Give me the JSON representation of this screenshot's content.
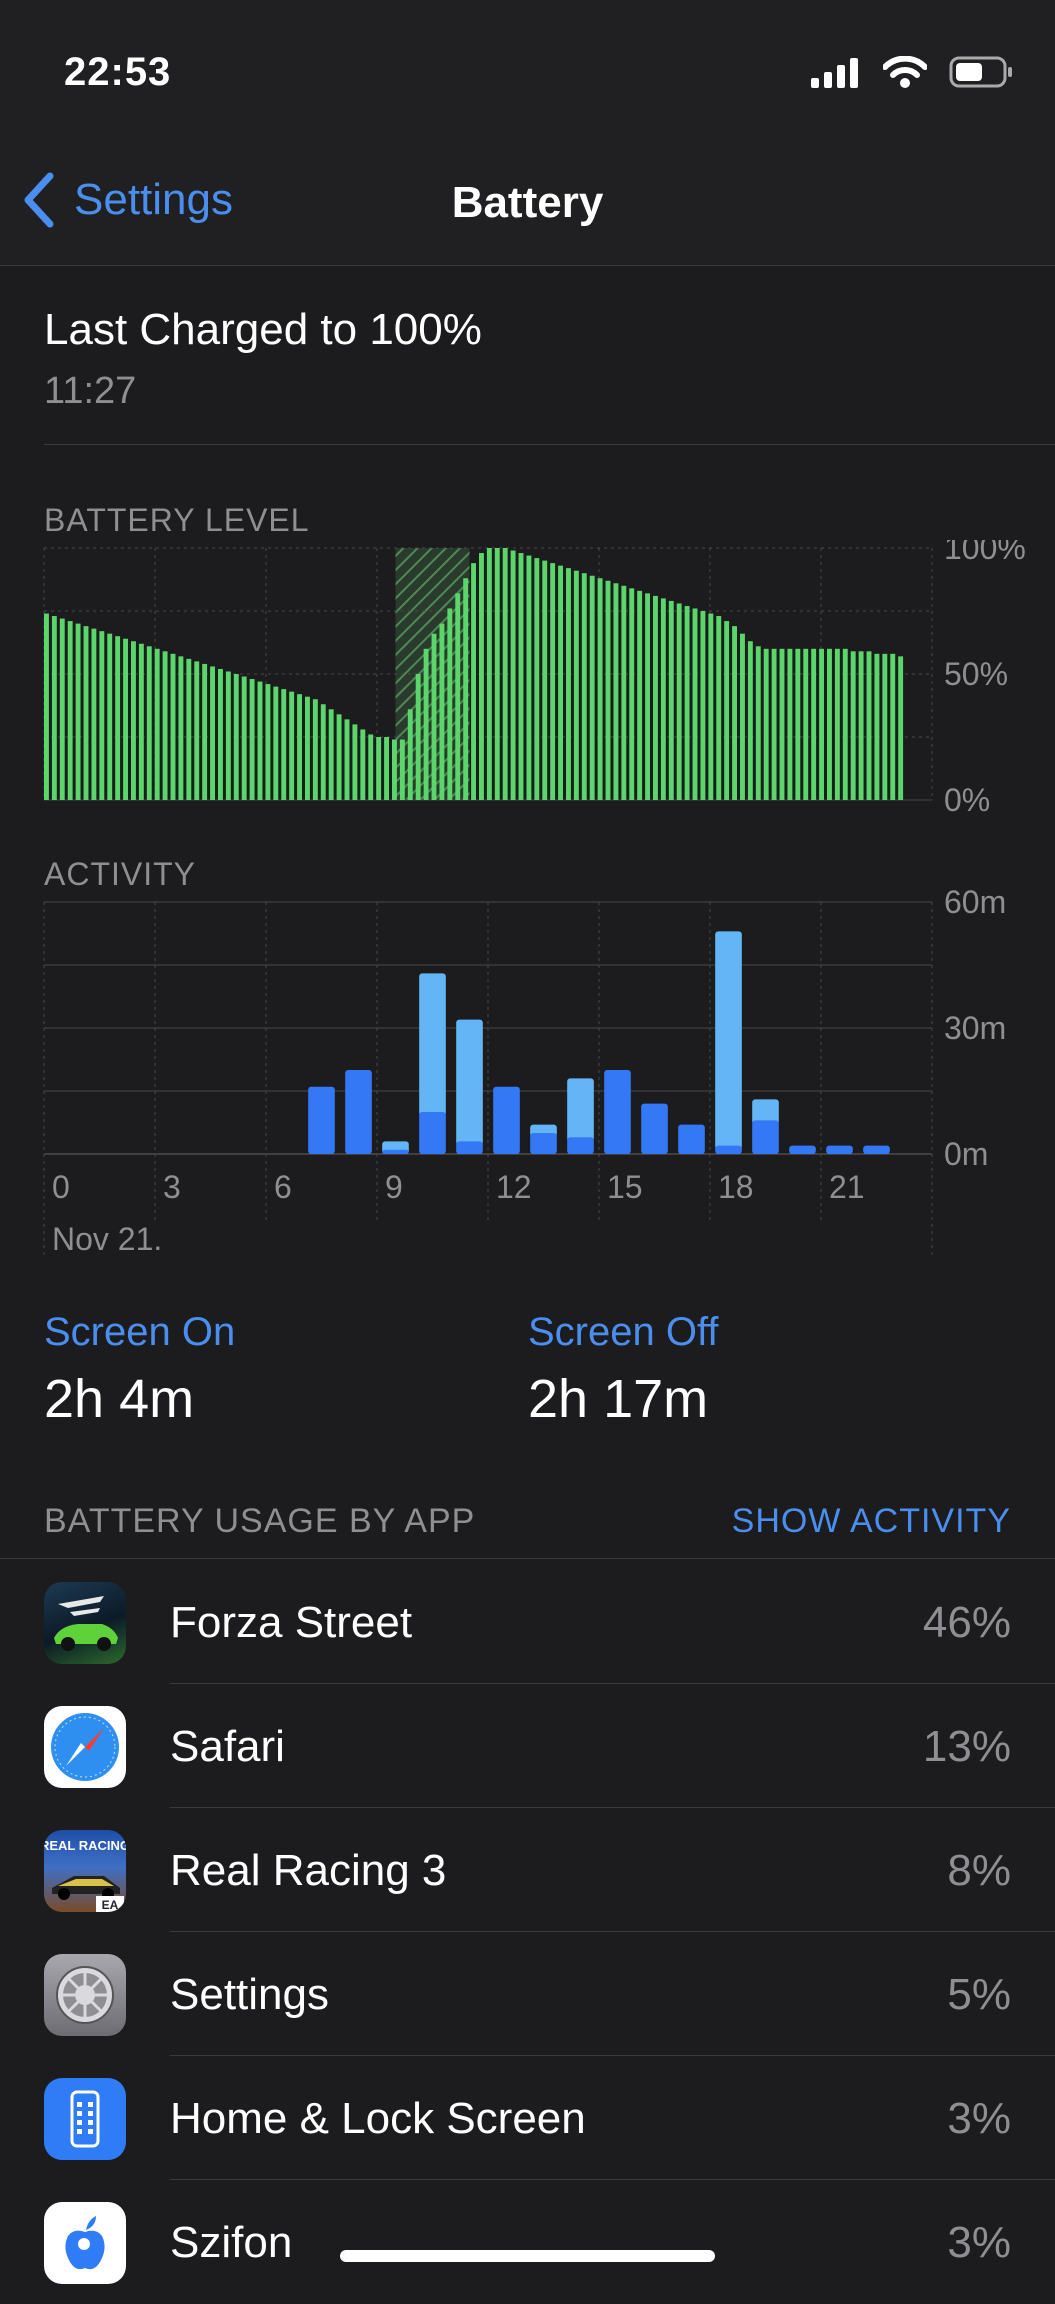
{
  "status": {
    "time": "22:53"
  },
  "nav": {
    "back_label": "Settings",
    "title": "Battery"
  },
  "last_charged": {
    "label": "Last Charged to 100%",
    "time": "11:27"
  },
  "battery_level": {
    "label": "BATTERY LEVEL",
    "y_ticks": [
      "100%",
      "50%",
      "0%"
    ]
  },
  "activity": {
    "label": "ACTIVITY",
    "y_ticks": [
      "60m",
      "30m",
      "0m"
    ],
    "x_ticks": [
      "0",
      "3",
      "6",
      "9",
      "12",
      "15",
      "18",
      "21"
    ],
    "date_label": "Nov 21."
  },
  "chart_data": [
    {
      "type": "bar",
      "title": "BATTERY LEVEL",
      "ylim": [
        0,
        100
      ],
      "y_ticks": [
        "100%",
        "50%",
        "0%"
      ],
      "x_range_hours": [
        0,
        24
      ],
      "charging_hours": [
        [
          9.5,
          11.5
        ]
      ],
      "values": [
        74,
        73,
        72,
        71,
        70,
        69,
        68,
        67,
        66,
        65,
        64,
        63,
        62,
        61,
        60,
        59,
        58,
        57,
        56,
        55,
        54,
        53,
        52,
        51,
        50,
        49,
        48,
        47,
        46,
        45,
        44,
        43,
        42,
        41,
        40,
        38,
        36,
        34,
        32,
        30,
        28,
        26,
        25,
        25,
        24,
        24,
        36,
        50,
        60,
        66,
        70,
        76,
        82,
        88,
        94,
        98,
        100,
        100,
        100,
        99,
        98,
        97,
        96,
        95,
        94,
        93,
        92,
        91,
        90,
        89,
        88,
        87,
        86,
        85,
        84,
        83,
        82,
        81,
        80,
        79,
        78,
        77,
        76,
        75,
        74,
        73,
        71,
        69,
        66,
        63,
        61,
        60,
        60,
        60,
        60,
        60,
        60,
        60,
        60,
        60,
        60,
        60,
        59,
        59,
        59,
        58,
        58,
        58,
        57
      ]
    },
    {
      "type": "bar",
      "title": "ACTIVITY",
      "ylim": [
        0,
        60
      ],
      "y_ticks": [
        "60m",
        "30m",
        "0m"
      ],
      "categories": [
        "0",
        "1",
        "2",
        "3",
        "4",
        "5",
        "6",
        "7",
        "8",
        "9",
        "10",
        "11",
        "12",
        "13",
        "14",
        "15",
        "16",
        "17",
        "18",
        "19",
        "20",
        "21",
        "22",
        "23"
      ],
      "x_tick_labels": [
        "0",
        "3",
        "6",
        "9",
        "12",
        "15",
        "18",
        "21"
      ],
      "series": [
        {
          "name": "Screen On",
          "color": "#3478f6",
          "values": [
            0,
            0,
            0,
            0,
            0,
            0,
            0,
            16,
            20,
            1,
            10,
            3,
            16,
            5,
            4,
            20,
            12,
            7,
            2,
            8,
            2,
            2,
            2,
            0
          ]
        },
        {
          "name": "Screen Off",
          "color": "#64b5f6",
          "values": [
            0,
            0,
            0,
            0,
            0,
            0,
            0,
            0,
            0,
            2,
            33,
            29,
            0,
            2,
            14,
            0,
            0,
            0,
            51,
            5,
            0,
            0,
            0,
            0
          ]
        }
      ]
    }
  ],
  "screen_stats": {
    "screen_on": {
      "label": "Screen On",
      "value": "2h 4m"
    },
    "screen_off": {
      "label": "Screen Off",
      "value": "2h 17m"
    }
  },
  "usage": {
    "header": "BATTERY USAGE BY APP",
    "show_activity": "SHOW ACTIVITY",
    "apps": [
      {
        "name": "Forza Street",
        "percent": "46%",
        "icon": "forza-street-icon"
      },
      {
        "name": "Safari",
        "percent": "13%",
        "icon": "safari-icon"
      },
      {
        "name": "Real Racing 3",
        "percent": "8%",
        "icon": "real-racing-3-icon",
        "icon_text": "REAL RACING",
        "icon_badge": "EA"
      },
      {
        "name": "Settings",
        "percent": "5%",
        "icon": "settings-gear-icon"
      },
      {
        "name": "Home & Lock Screen",
        "percent": "3%",
        "icon": "home-lock-screen-icon"
      },
      {
        "name": "Szifon",
        "percent": "3%",
        "icon": "szifon-icon"
      }
    ]
  },
  "colors": {
    "accent": "#4a8ff0",
    "battery_green": "#5ad66a",
    "screen_on": "#3478f6",
    "screen_off": "#64b5f6",
    "background": "#1c1c1e"
  }
}
